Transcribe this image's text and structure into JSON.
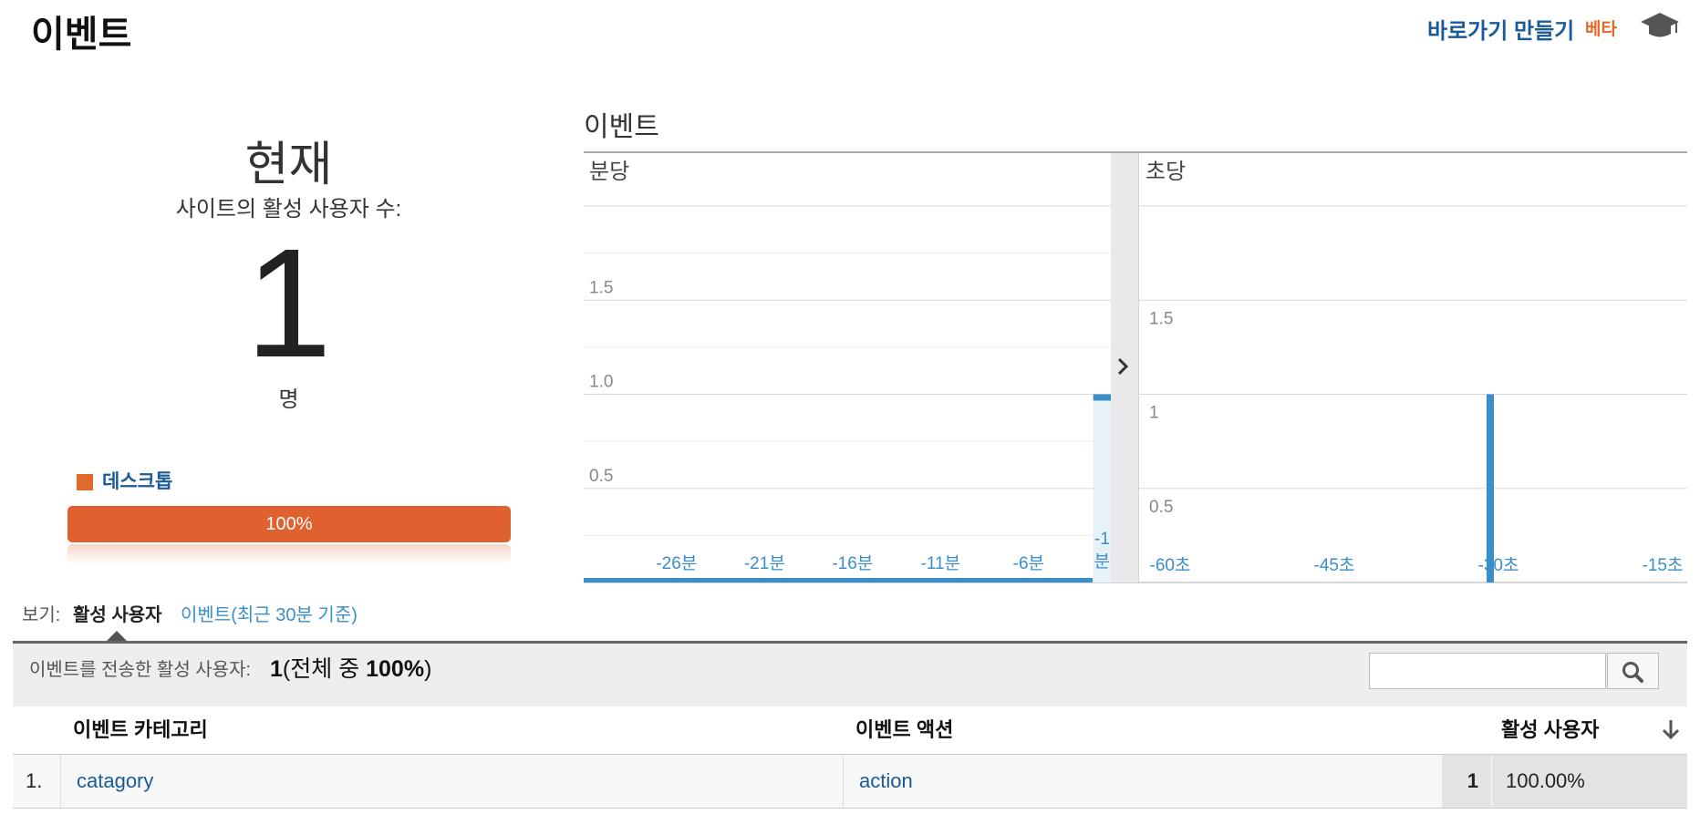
{
  "header": {
    "title": "이벤트",
    "shortcut_label": "바로가기 만들기",
    "beta_label": "베타"
  },
  "overview": {
    "now_label": "현재",
    "active_users_label": "사이트의 활성 사용자 수:",
    "active_users_count": "1",
    "unit": "명",
    "device_legend": "데스크톱",
    "device_share_percent": 100,
    "device_share_label": "100%"
  },
  "chart_data": [
    {
      "type": "bar",
      "title": "이벤트",
      "subtitle": "분당",
      "x_ticks": [
        "-26분",
        "-21분",
        "-16분",
        "-11분",
        "-6분",
        "-1분"
      ],
      "y_ticks": [
        "0.5",
        "1.0",
        "1.5"
      ],
      "ylim": [
        0,
        2
      ],
      "values_by_minute_ago": {
        "-30": 0,
        "-29": 0,
        "-28": 0,
        "-27": 0,
        "-26": 0,
        "-25": 0,
        "-24": 0,
        "-23": 0,
        "-22": 0,
        "-21": 0,
        "-20": 0,
        "-19": 0,
        "-18": 0,
        "-17": 0,
        "-16": 0,
        "-15": 0,
        "-14": 0,
        "-13": 0,
        "-12": 0,
        "-11": 0,
        "-10": 0,
        "-9": 0,
        "-8": 0,
        "-7": 0,
        "-6": 0,
        "-5": 0,
        "-4": 0,
        "-3": 0,
        "-2": 0,
        "-1": 1
      },
      "highlighted_minute": "-1분",
      "grid": true
    },
    {
      "type": "bar",
      "subtitle": "초당",
      "x_ticks": [
        "-60초",
        "-45초",
        "-30초",
        "-15초"
      ],
      "y_ticks": [
        "0.5",
        "1",
        "1.5"
      ],
      "ylim": [
        0,
        2
      ],
      "bars": [
        {
          "x_seconds_ago": -30,
          "value": 1
        }
      ],
      "grid": true
    }
  ],
  "view": {
    "label": "보기:",
    "tabs": [
      "활성 사용자",
      "이벤트(최근 30분 기준)"
    ],
    "active_tab": "활성 사용자"
  },
  "summary": {
    "label": "이벤트를 전송한 활성 사용자:",
    "count": "1",
    "paren_open": "(전체 중 ",
    "percent": "100%",
    "paren_close": ")"
  },
  "search": {
    "value": ""
  },
  "table": {
    "headers": [
      "이벤트 카테고리",
      "이벤트 액션",
      "활성 사용자"
    ],
    "rows": [
      {
        "index": "1.",
        "category": "catagory",
        "action": "action",
        "users": "1",
        "share": "100.00%"
      }
    ]
  },
  "colors": {
    "accent_orange": "#e06130",
    "link_blue": "#1a5a96",
    "chart_blue": "#3a8ec9"
  }
}
